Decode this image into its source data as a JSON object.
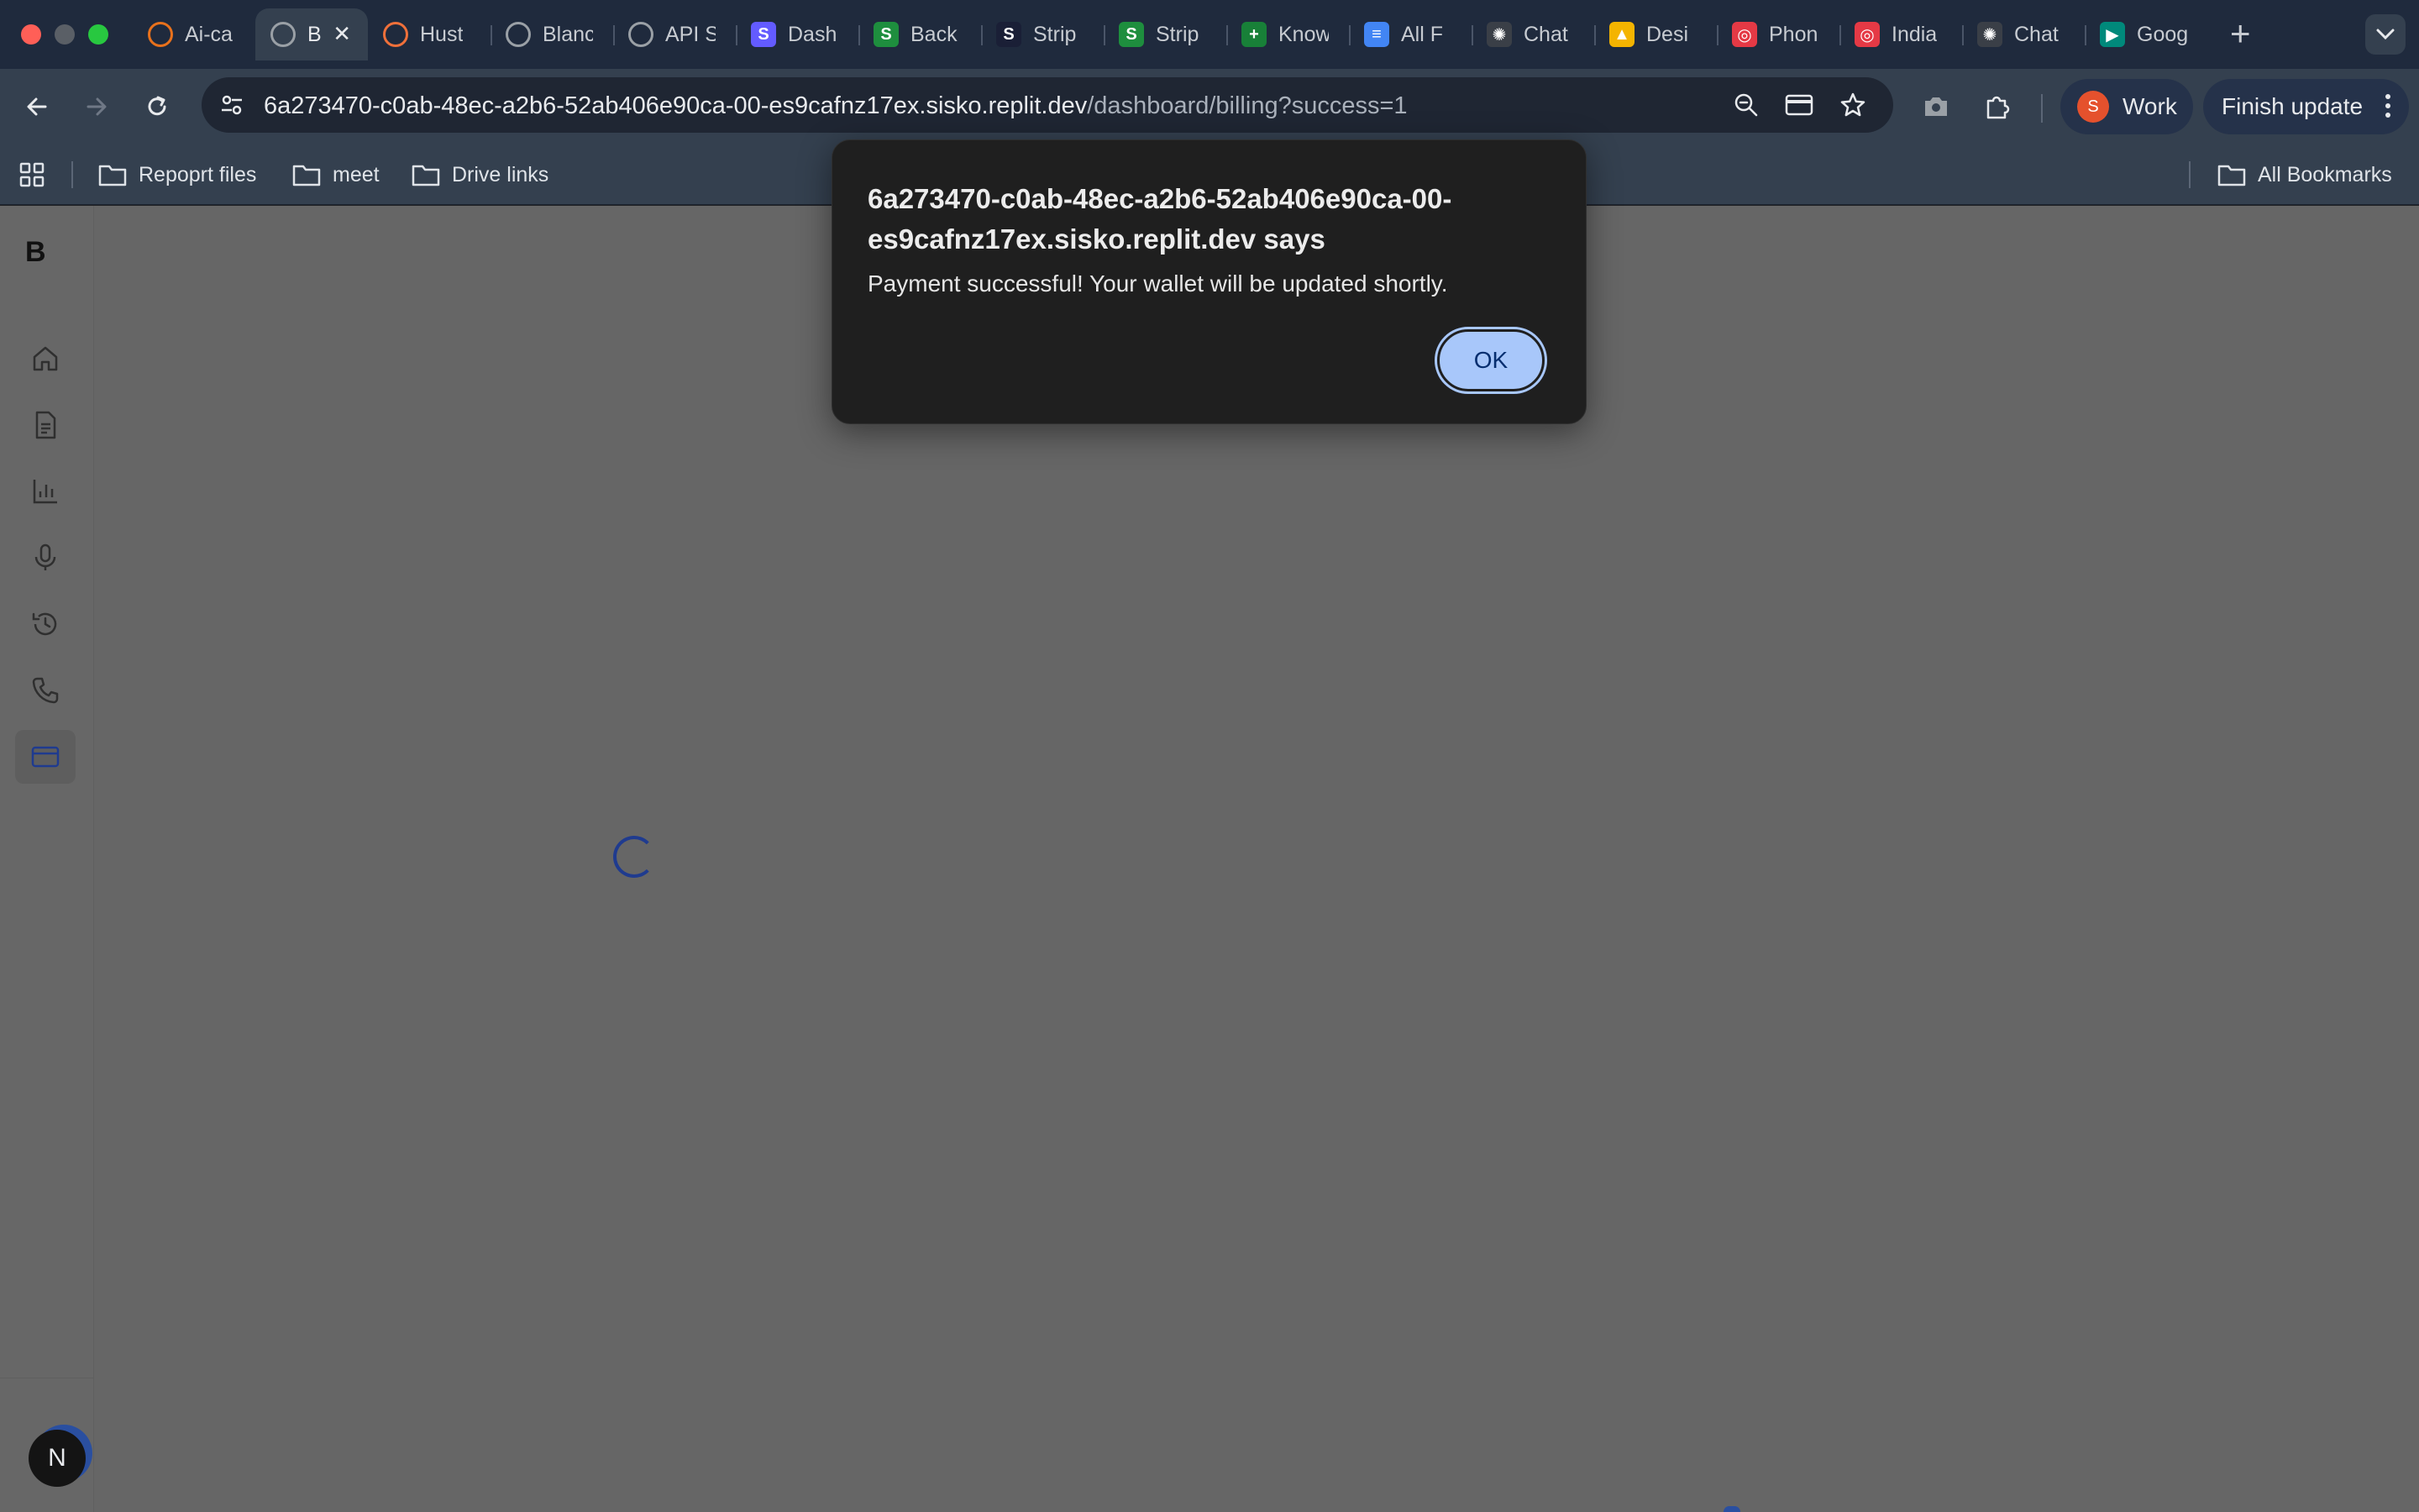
{
  "browser": {
    "tabs": [
      {
        "label": "Ai-ca",
        "icon": "ai-logo-icon",
        "color": "#e8711c"
      },
      {
        "label": "B",
        "icon": "globe-icon",
        "color": "#9aa0a6",
        "active": true
      },
      {
        "label": "Hust",
        "icon": "hustle-icon",
        "color": "#f0703a"
      },
      {
        "label": "Blanc",
        "icon": "globe-icon",
        "color": "#9aa0a6"
      },
      {
        "label": "API S",
        "icon": "globe-icon",
        "color": "#9aa0a6"
      },
      {
        "label": "Dash",
        "icon": "stripe-icon",
        "color": "#635bff",
        "glyph": "S"
      },
      {
        "label": "Back",
        "icon": "sheets-s-icon",
        "color": "#1e8e3e",
        "glyph": "S"
      },
      {
        "label": "Strip",
        "icon": "stripe-icon",
        "color": "#1a1f36",
        "glyph": "S"
      },
      {
        "label": "Strip",
        "icon": "sheets-s-icon",
        "color": "#1e8e3e",
        "glyph": "S"
      },
      {
        "label": "Know",
        "icon": "sheets-icon",
        "color": "#188038",
        "glyph": "+"
      },
      {
        "label": "All F",
        "icon": "docs-icon",
        "color": "#4285f4",
        "glyph": "≡"
      },
      {
        "label": "Chat",
        "icon": "openai-icon",
        "color": "#3a3f47",
        "glyph": "✺"
      },
      {
        "label": "Desi",
        "icon": "drive-icon",
        "color": "#f4b400",
        "glyph": "▲"
      },
      {
        "label": "Phon",
        "icon": "target-icon",
        "color": "#e53945",
        "glyph": "◎"
      },
      {
        "label": "India",
        "icon": "target-icon",
        "color": "#e53945",
        "glyph": "◎"
      },
      {
        "label": "Chat",
        "icon": "openai-icon",
        "color": "#3a3f47",
        "glyph": "✺"
      },
      {
        "label": "Goog",
        "icon": "meet-icon",
        "color": "#00897b",
        "glyph": "▶"
      }
    ],
    "url_host": "6a273470-c0ab-48ec-a2b6-52ab406e90ca-00-es9cafnz17ex.sisko.replit.dev",
    "url_path": "/dashboard/billing?success=1",
    "profile_initial": "S",
    "profile_label": "Work",
    "finish_update_label": "Finish update",
    "bookmarks": [
      {
        "label": "Repoprt files"
      },
      {
        "label": "meet"
      },
      {
        "label": "Drive links"
      }
    ],
    "all_bookmarks_label": "All Bookmarks"
  },
  "app": {
    "brand": "B",
    "nav_items": [
      "home",
      "documents",
      "analytics",
      "microphone",
      "history",
      "phone",
      "billing"
    ],
    "active_nav": "billing",
    "user_initial": "N",
    "loading": true
  },
  "dialog": {
    "title": "6a273470-c0ab-48ec-a2b6-52ab406e90ca-00-es9cafnz17ex.sisko.replit.dev says",
    "message": "Payment successful! Your wallet will be updated shortly.",
    "ok_label": "OK"
  }
}
